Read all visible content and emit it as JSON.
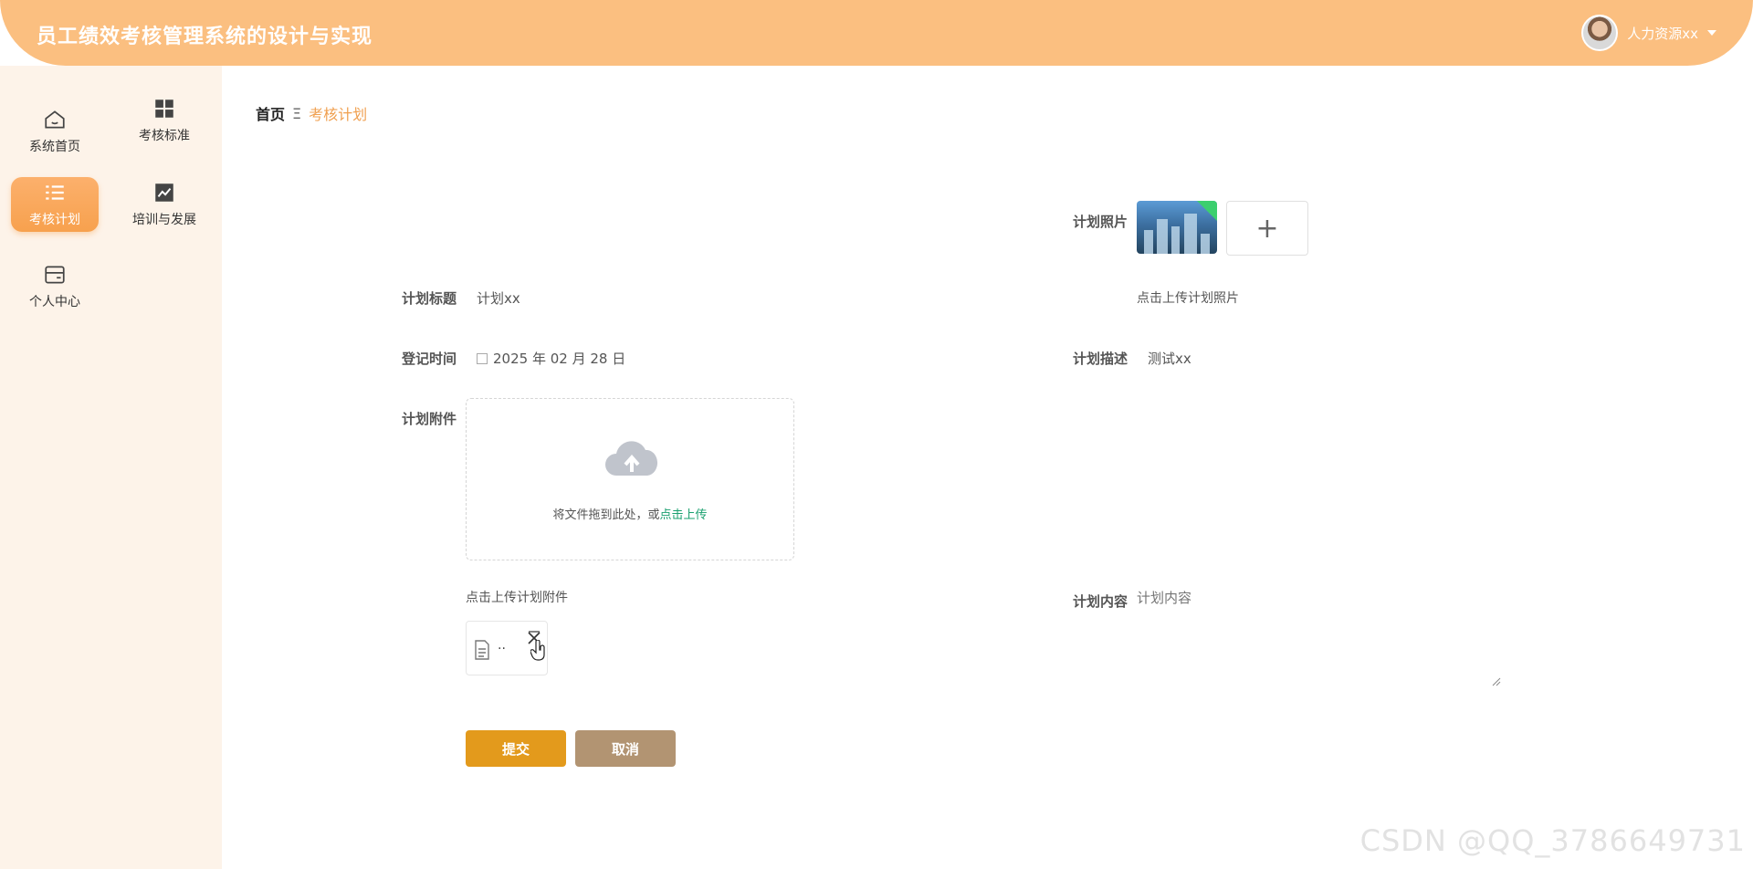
{
  "app": {
    "title": "员工绩效考核管理系统的设计与实现"
  },
  "user": {
    "name": "人力资源xx"
  },
  "sidebar": {
    "items": [
      {
        "label": "系统首页",
        "icon": "home-icon"
      },
      {
        "label": "考核标准",
        "icon": "grid-icon"
      },
      {
        "label": "考核计划",
        "icon": "list-icon",
        "active": true
      },
      {
        "label": "培训与发展",
        "icon": "chart-line-icon"
      },
      {
        "label": "个人中心",
        "icon": "card-icon"
      }
    ]
  },
  "breadcrumb": {
    "home": "首页",
    "separator": "Ξ",
    "current": "考核计划"
  },
  "form": {
    "photo_label": "计划照片",
    "photo_hint": "点击上传计划照片",
    "title_label": "计划标题",
    "title_value": "计划xx",
    "date_label": "登记时间",
    "date_value": "2025 年 02 月 28 日",
    "desc_label": "计划描述",
    "desc_value": "测试xx",
    "attachment_label": "计划附件",
    "upload_text": "将文件拖到此处，或",
    "upload_link": "点击上传",
    "attachment_hint": "点击上传计划附件",
    "file_name": "··",
    "content_label": "计划内容",
    "content_placeholder": "计划内容",
    "submit": "提交",
    "cancel": "取消"
  },
  "watermark": "CSDN @QQ_3786649731",
  "colors": {
    "header": "#fbbf80",
    "sidebar": "#fdf3e9",
    "accent": "#f7a14e",
    "submit": "#e39a1c",
    "cancel": "#b29472",
    "link": "#1aa06f"
  }
}
